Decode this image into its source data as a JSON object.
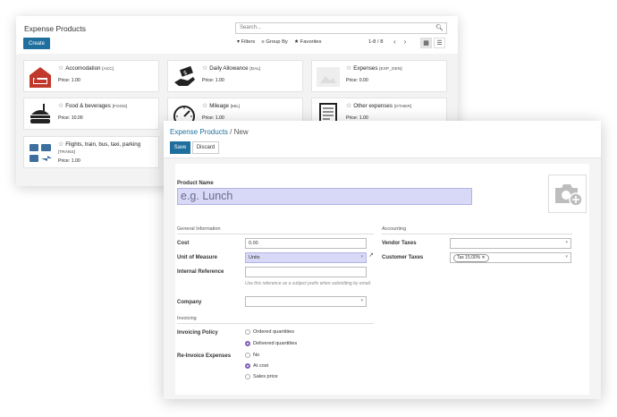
{
  "kanban": {
    "title": "Expense Products",
    "search_placeholder": "Search...",
    "create_label": "Create",
    "filters_label": "Filters",
    "groupby_label": "Group By",
    "favorites_label": "Favorites",
    "pager": "1-8 / 8",
    "cards": [
      {
        "name": "Accomodation",
        "code": "[ACC]",
        "price": "Price: 1.00",
        "icon": "hotel-icon"
      },
      {
        "name": "Daily Allowance",
        "code": "[DAL]",
        "price": "Price: 1.00",
        "icon": "money-hand-icon"
      },
      {
        "name": "Expenses",
        "code": "[EXP_GEN]",
        "price": "Price: 0.00",
        "icon": "placeholder-image-icon"
      },
      {
        "name": "Food & beverages",
        "code": "[FOOD]",
        "price": "Price: 10.00",
        "icon": "burger-icon"
      },
      {
        "name": "Mileage",
        "code": "[MIL]",
        "price": "Price: 1.00",
        "icon": "speedometer-icon"
      },
      {
        "name": "Other expenses",
        "code": "[OTHER]",
        "price": "Price: 1.00",
        "icon": "document-icon"
      },
      {
        "name": "Flights, train, bus, taxi, parking",
        "code": "[TRANS]",
        "price": "Price: 1.00",
        "icon": "transport-icon"
      }
    ]
  },
  "form": {
    "breadcrumb_parent": "Expense Products",
    "breadcrumb_sep": " / ",
    "breadcrumb_current": "New",
    "save_label": "Save",
    "discard_label": "Discard",
    "product_name_label": "Product Name",
    "product_name_placeholder": "e.g. Lunch",
    "general_info_title": "General Information",
    "cost_label": "Cost",
    "cost_value": "0.00",
    "uom_label": "Unit of Measure",
    "uom_value": "Units",
    "internal_ref_label": "Internal Reference",
    "internal_ref_hint": "Use this reference as a subject prefix when submitting by email.",
    "company_label": "Company",
    "accounting_title": "Accounting",
    "vendor_taxes_label": "Vendor Taxes",
    "customer_taxes_label": "Customer Taxes",
    "customer_tax_tag": "Tax 15.00%",
    "invoicing_title": "Invoicing",
    "invoicing_policy_label": "Invoicing Policy",
    "invoicing_policy_options": [
      "Ordered quantities",
      "Delivered quantities"
    ],
    "invoicing_policy_selected": 1,
    "reinvoice_label": "Re-Invoice Expenses",
    "reinvoice_options": [
      "No",
      "At cost",
      "Sales price"
    ],
    "reinvoice_selected": 1
  },
  "colors": {
    "primary": "#1f6f9e",
    "highlight": "#d8d8f7",
    "radio_active": "#7b5fb5"
  }
}
